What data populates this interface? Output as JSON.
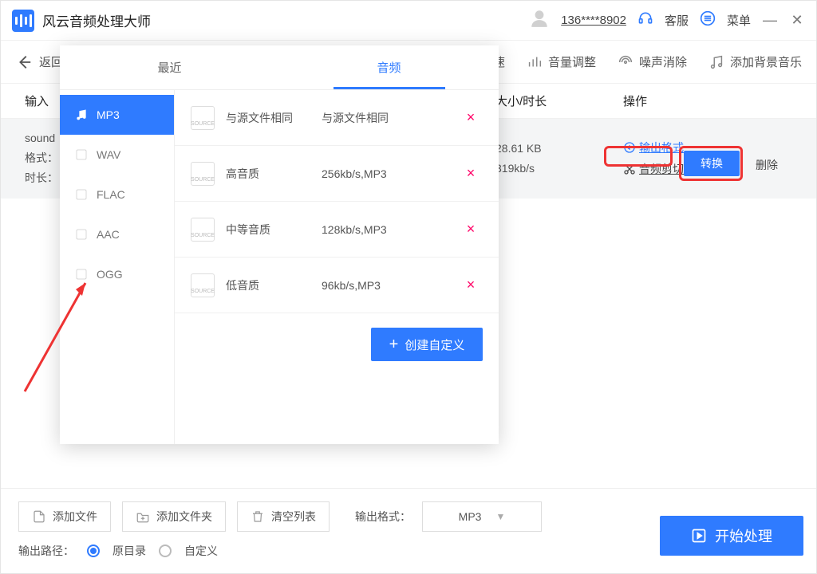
{
  "app_title": "风云音频处理大师",
  "phone": "136****8902",
  "kefu": "客服",
  "menu": "菜单",
  "back": "返回",
  "tools": {
    "speed": "速",
    "volume": "音量调整",
    "denoise": "噪声消除",
    "bgm": "添加背景音乐"
  },
  "cols": {
    "input": "输入",
    "size": "大小/时长",
    "ops": "操作"
  },
  "row": {
    "name": "sound",
    "fmt_lbl": "格式：",
    "dur_lbl": "时长：",
    "size": "28.61 KB",
    "bitrate": "319kb/s"
  },
  "ops": {
    "out_fmt": "输出格式",
    "trim": "音频剪切",
    "convert": "转换",
    "delete": "删除"
  },
  "popup": {
    "tab_recent": "最近",
    "tab_audio": "音频",
    "formats": [
      "MP3",
      "WAV",
      "FLAC",
      "AAC",
      "OGG"
    ],
    "quality": [
      {
        "name": "与源文件相同",
        "spec": "与源文件相同"
      },
      {
        "name": "高音质",
        "spec": "256kb/s,MP3"
      },
      {
        "name": "中等音质",
        "spec": "128kb/s,MP3"
      },
      {
        "name": "低音质",
        "spec": "96kb/s,MP3"
      }
    ],
    "create": "创建自定义"
  },
  "bottom": {
    "add_file": "添加文件",
    "add_folder": "添加文件夹",
    "clear": "清空列表",
    "out_fmt_lbl": "输出格式：",
    "out_fmt_val": "MP3",
    "out_path_lbl": "输出路径：",
    "orig": "原目录",
    "custom": "自定义",
    "start": "开始处理"
  }
}
